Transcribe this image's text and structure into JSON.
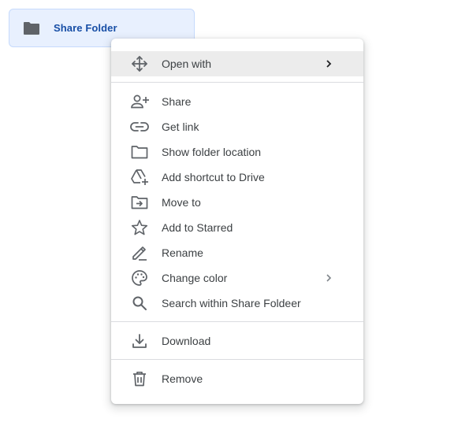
{
  "folder": {
    "label": "Share Folder",
    "icon": "folder-icon"
  },
  "menu": {
    "open_with": {
      "label": "Open with",
      "icon": "move-arrows-icon",
      "has_submenu": true
    },
    "share": {
      "label": "Share",
      "icon": "person-add-icon"
    },
    "get_link": {
      "label": "Get link",
      "icon": "link-icon"
    },
    "show_folder_location": {
      "label": "Show folder location",
      "icon": "folder-outline-icon"
    },
    "add_shortcut": {
      "label": "Add shortcut to Drive",
      "icon": "drive-add-icon"
    },
    "move_to": {
      "label": "Move to",
      "icon": "folder-move-icon"
    },
    "add_to_starred": {
      "label": "Add to Starred",
      "icon": "star-outline-icon"
    },
    "rename": {
      "label": "Rename",
      "icon": "pencil-icon"
    },
    "change_color": {
      "label": "Change color",
      "icon": "palette-icon",
      "has_submenu": true
    },
    "search_within": {
      "label": "Search within Share Foldeer",
      "icon": "search-icon"
    },
    "download": {
      "label": "Download",
      "icon": "download-icon"
    },
    "remove": {
      "label": "Remove",
      "icon": "trash-icon"
    }
  },
  "colors": {
    "chip_bg": "#e8f0fe",
    "chip_text": "#174ea6",
    "icon_gray": "#5f6368",
    "text_gray": "#3c4043",
    "highlight": "#ececec"
  }
}
